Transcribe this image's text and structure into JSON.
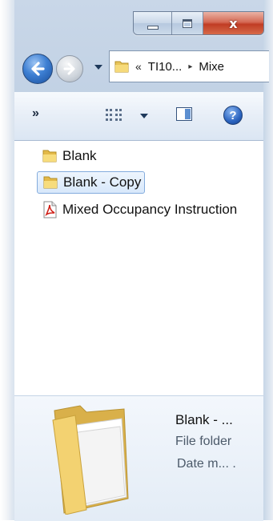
{
  "window": {
    "caption": {
      "minimize_icon": "minimize-icon",
      "maximize_icon": "maximize-icon",
      "close_label": "x"
    }
  },
  "nav": {
    "back_icon": "back-arrow-icon",
    "forward_icon": "forward-arrow-icon",
    "address": {
      "overflow_chevron": "«",
      "crumb_1": "TI10...",
      "separator": "▸",
      "crumb_2": "Mixe"
    }
  },
  "toolbar": {
    "more_label": "»",
    "views_icon": "views-icon",
    "preview_pane_icon": "preview-pane-icon",
    "help_label": "?"
  },
  "files": [
    {
      "name": "Blank",
      "icon": "folder-icon",
      "selected": false
    },
    {
      "name": "Blank - Copy",
      "icon": "folder-icon",
      "selected": true
    },
    {
      "name": "Mixed Occupancy Instruction",
      "icon": "pdf-icon",
      "selected": false
    }
  ],
  "details": {
    "name": "Blank - ...",
    "type": "File folder",
    "date": "Date m... ."
  },
  "colors": {
    "selection_border": "#84acdd",
    "close_button": "#c03c24",
    "frame": "#c9d7e8"
  }
}
